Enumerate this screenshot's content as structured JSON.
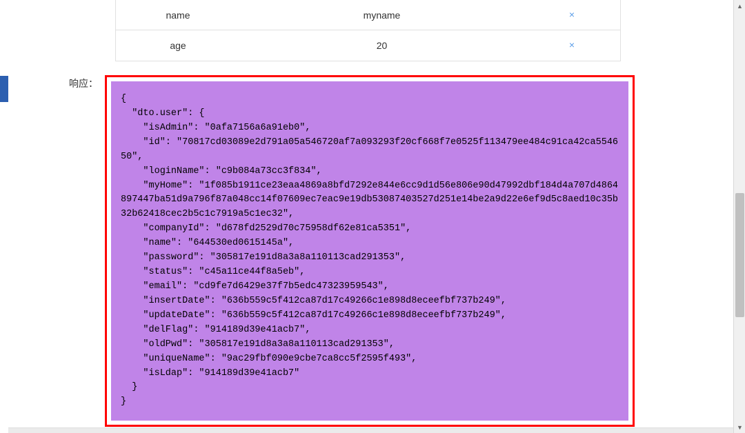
{
  "table": {
    "rows": [
      {
        "key": "name",
        "value": "myname"
      },
      {
        "key": "age",
        "value": "20"
      }
    ]
  },
  "response": {
    "label": "响应：",
    "body": "{\n  \"dto.user\": {\n    \"isAdmin\": \"0afa7156a6a91eb0\",\n    \"id\": \"70817cd03089e2d791a05a546720af7a093293f20cf668f7e0525f113479ee484c91ca42ca554650\",\n    \"loginName\": \"c9b084a73cc3f834\",\n    \"myHome\": \"1f085b1911ce23eaa4869a8bfd7292e844e6cc9d1d56e806e90d47992dbf184d4a707d4864897447ba51d9a796f87a048cc14f07609ec7eac9e19db53087403527d251e14be2a9d22e6ef9d5c8aed10c35b32b62418cec2b5c1c7919a5c1ec32\",\n    \"companyId\": \"d678fd2529d70c75958df62e81ca5351\",\n    \"name\": \"644530ed0615145a\",\n    \"password\": \"305817e191d8a3a8a110113cad291353\",\n    \"status\": \"c45a11ce44f8a5eb\",\n    \"email\": \"cd9fe7d6429e37f7b5edc47323959543\",\n    \"insertDate\": \"636b559c5f412ca87d17c49266c1e898d8eceefbf737b249\",\n    \"updateDate\": \"636b559c5f412ca87d17c49266c1e898d8eceefbf737b249\",\n    \"delFlag\": \"914189d39e41acb7\",\n    \"oldPwd\": \"305817e191d8a3a8a110113cad291353\",\n    \"uniqueName\": \"9ac29fbf090e9cbe7ca8cc5f2595f493\",\n    \"isLdap\": \"914189d39e41acb7\"\n  }\n}"
  }
}
